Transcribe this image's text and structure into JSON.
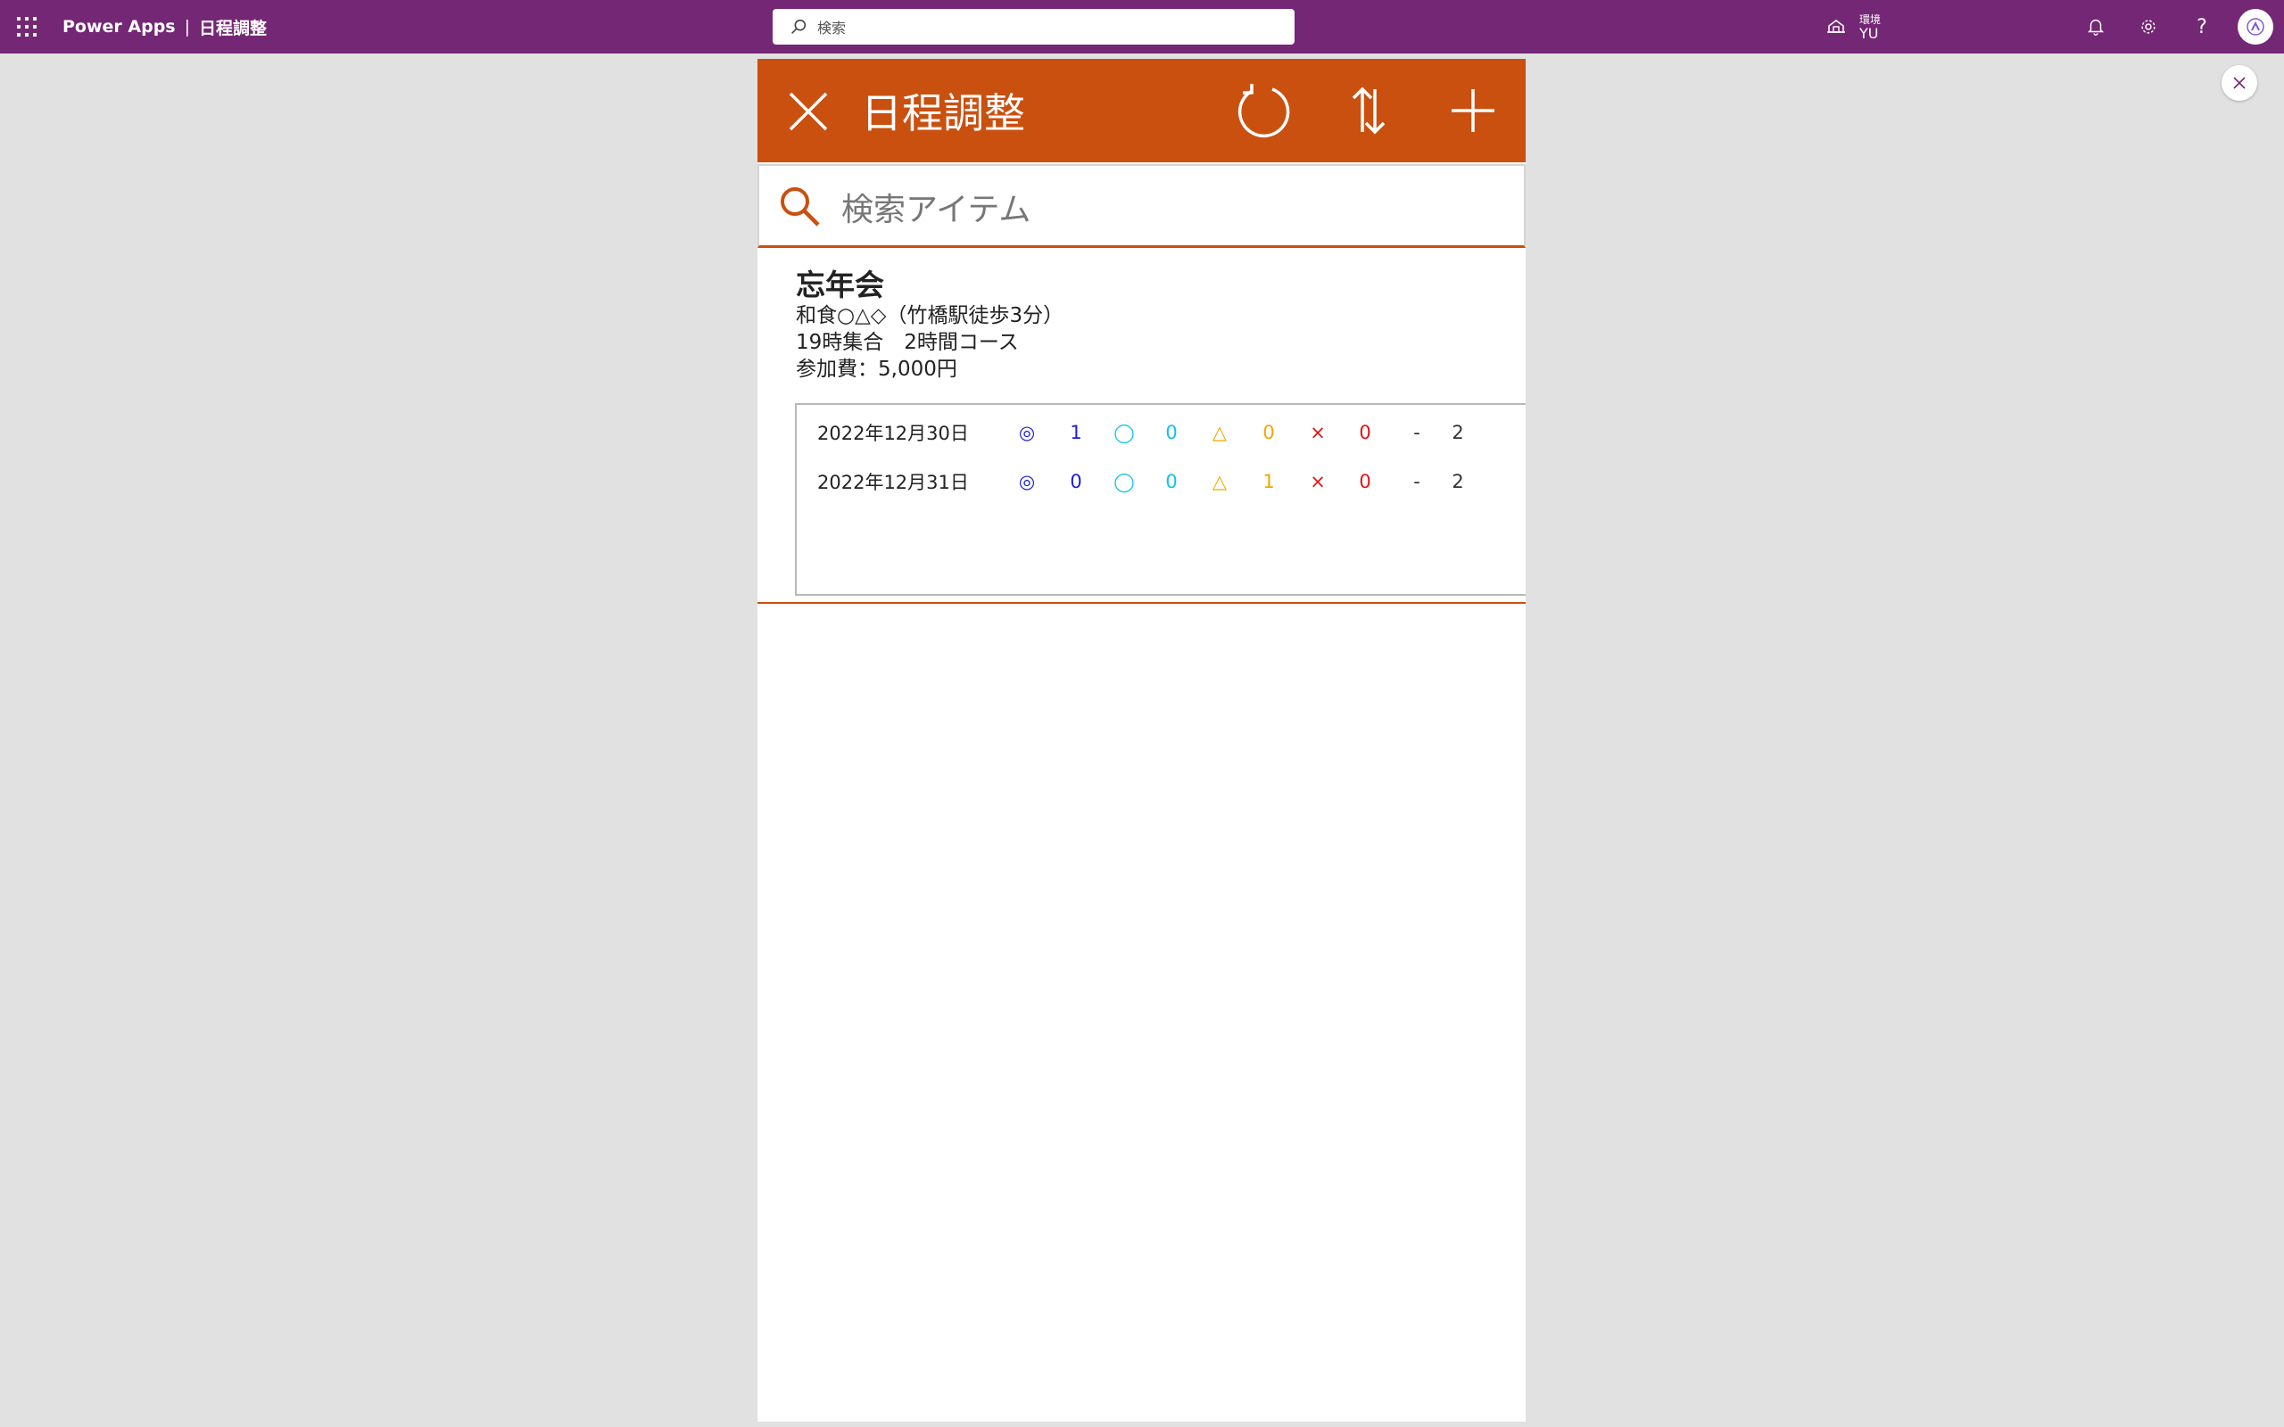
{
  "topbar": {
    "product": "Power Apps",
    "separator": "|",
    "app_name": "日程調整",
    "search_placeholder": "検索",
    "environment_label": "環境",
    "environment_name": "YU",
    "help_label": "?"
  },
  "app": {
    "title": "日程調整",
    "search_placeholder": "検索アイテム",
    "header_buttons": [
      "close",
      "refresh",
      "sort",
      "add"
    ],
    "accent_color": "#ca5010"
  },
  "event": {
    "title": "忘年会",
    "lines": [
      "和食○△◇（竹橋駅徒歩3分）",
      "19時集合　2時間コース",
      "参加費：5,000円"
    ],
    "dates": [
      {
        "date": "2022年12月30日",
        "counts": {
          "double_circle_symbol": "◎",
          "double_circle": "1",
          "circle_symbol": "◯",
          "circle": "0",
          "triangle_symbol": "△",
          "triangle": "0",
          "cross_symbol": "×",
          "cross": "0",
          "dash_symbol": "-",
          "dash": "2"
        }
      },
      {
        "date": "2022年12月31日",
        "counts": {
          "double_circle_symbol": "◎",
          "double_circle": "0",
          "circle_symbol": "◯",
          "circle": "0",
          "triangle_symbol": "△",
          "triangle": "1",
          "cross_symbol": "×",
          "cross": "0",
          "dash_symbol": "-",
          "dash": "2"
        }
      }
    ]
  },
  "colors": {
    "topbar": "#742774",
    "double_circle": "#1d1dd6",
    "circle": "#15c3e6",
    "triangle": "#f0a800",
    "cross": "#e01515",
    "dash": "#333333"
  }
}
